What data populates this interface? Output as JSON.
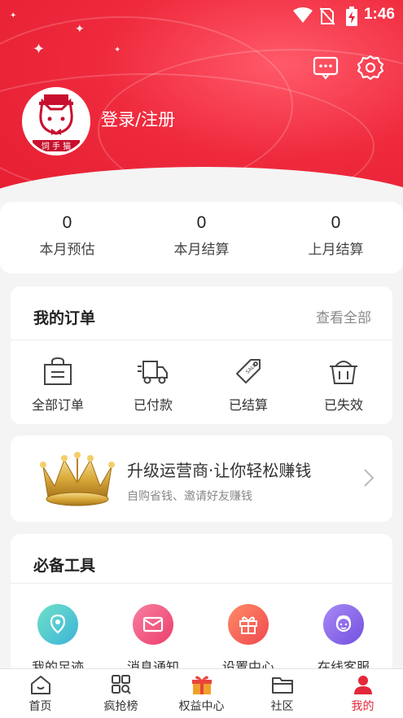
{
  "status_bar": {
    "time": "1:46"
  },
  "profile": {
    "login_label": "登录/注册"
  },
  "stats": [
    {
      "value": "0",
      "label": "本月预估"
    },
    {
      "value": "0",
      "label": "本月结算"
    },
    {
      "value": "0",
      "label": "上月结算"
    }
  ],
  "orders": {
    "title": "我的订单",
    "view_all": "查看全部",
    "items": [
      {
        "label": "全部订单",
        "icon": "shopping-bag-icon"
      },
      {
        "label": "已付款",
        "icon": "delivery-truck-icon"
      },
      {
        "label": "已结算",
        "icon": "sale-tag-icon"
      },
      {
        "label": "已失效",
        "icon": "basket-icon"
      }
    ]
  },
  "upgrade": {
    "title": "升级运营商·让你轻松赚钱",
    "subtitle": "自购省钱、邀请好友赚钱"
  },
  "tools": {
    "title": "必备工具",
    "items": [
      {
        "label": "我的足迹",
        "icon": "location-pin-icon",
        "color": "#3cc6c0"
      },
      {
        "label": "消息通知",
        "icon": "envelope-icon",
        "color": "#f0527a"
      },
      {
        "label": "设置中心",
        "icon": "gift-icon",
        "color": "#f25b4e"
      },
      {
        "label": "在线客服",
        "icon": "customer-service-icon",
        "color": "#8a63e8"
      }
    ]
  },
  "tabbar": [
    {
      "label": "首页",
      "icon": "home-icon"
    },
    {
      "label": "疯抢榜",
      "icon": "grid-search-icon"
    },
    {
      "label": "权益中心",
      "icon": "gift-box-icon"
    },
    {
      "label": "社区",
      "icon": "folder-icon"
    },
    {
      "label": "我的",
      "icon": "user-icon",
      "active": true
    }
  ],
  "colors": {
    "brand_red": "#e51d31",
    "active_tab": "#e4273a"
  }
}
